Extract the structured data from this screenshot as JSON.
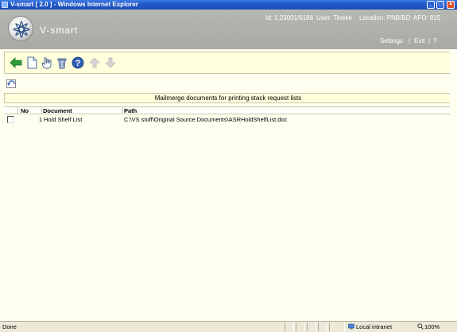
{
  "window": {
    "title": "V-smart [ 2.0 ] - Windows Internet Explorer",
    "controls": {
      "minimize": "_",
      "maximize": "□",
      "close": "×"
    }
  },
  "header": {
    "brand": "V-smart",
    "id_label": "Id: 1.23001/6188",
    "user_label": "User: Tineke",
    "location_label": "Location: PNB/BD",
    "afo_label": "AFO: 815",
    "links": {
      "settings": "Settings",
      "exit": "Exit",
      "help": "?"
    },
    "separator": "|"
  },
  "toolbar": {
    "icons": [
      "back-arrow-icon",
      "new-document-icon",
      "select-hand-icon",
      "delete-trash-icon",
      "help-icon",
      "up-arrow-icon",
      "down-arrow-icon"
    ]
  },
  "caption": "Mailmerge documents for printing stack request lists",
  "table": {
    "headers": {
      "no": "No",
      "document": "Document",
      "path": "Path"
    },
    "rows": [
      {
        "no": "1",
        "document": "Hold Shelf List",
        "path": "C:\\VS stuff\\Original Source Documents\\ASRHoldShelfList.doc"
      }
    ]
  },
  "statusbar": {
    "status": "Done",
    "zone": "Local intranet",
    "zoom": "100%"
  },
  "colors": {
    "titlebar": "#2359c9",
    "header": "#aeaea8",
    "content_bg": "#fffff0",
    "toolbar_bg": "#ffffdc",
    "accent_green": "#2e9d3a"
  }
}
